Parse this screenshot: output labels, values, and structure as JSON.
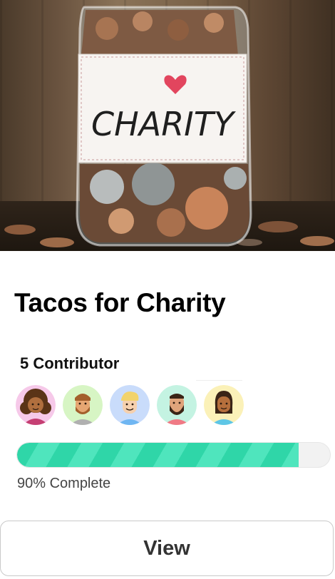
{
  "campaign": {
    "image_label": "CHARITY",
    "title": "Tacos for Charity",
    "contributors_label": "5 Contributor",
    "progress": 0.9,
    "progress_text": "90% Complete",
    "view_label": "View"
  },
  "contributors": [
    {
      "name": "avatar-1",
      "bg": "#f6c9e9"
    },
    {
      "name": "avatar-2",
      "bg": "#d7f5c4"
    },
    {
      "name": "avatar-3",
      "bg": "#c9dcfb"
    },
    {
      "name": "avatar-4",
      "bg": "#c4f3e2"
    },
    {
      "name": "avatar-5",
      "bg": "#fbf1b8"
    }
  ],
  "colors": {
    "progress": "#2fd6a8",
    "heart": "#e2455e"
  }
}
